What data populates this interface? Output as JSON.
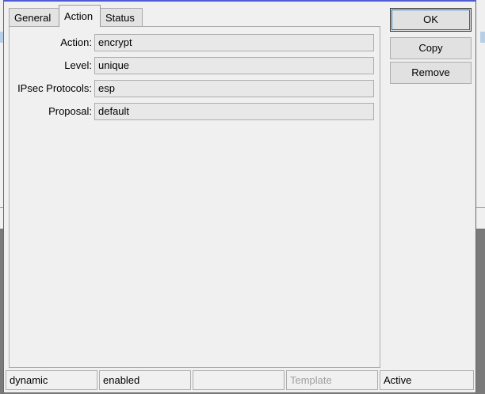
{
  "tabs": [
    {
      "label": "General"
    },
    {
      "label": "Action",
      "active": true
    },
    {
      "label": "Status"
    }
  ],
  "form": {
    "action": {
      "label": "Action:",
      "value": "encrypt"
    },
    "level": {
      "label": "Level:",
      "value": "unique"
    },
    "ipsec_protocols": {
      "label": "IPsec Protocols:",
      "value": "esp"
    },
    "proposal": {
      "label": "Proposal:",
      "value": "default"
    }
  },
  "buttons": {
    "ok": "OK",
    "copy": "Copy",
    "remove": "Remove"
  },
  "status_bar": {
    "cell1": "dynamic",
    "cell2": "enabled",
    "cell3": "",
    "cell4": "Template",
    "cell5": "Active"
  },
  "colors": {
    "window_bg": "#f0f0f0",
    "field_bg": "#e8e8e8",
    "border": "#adadad",
    "disabled_text": "#a0a0a0",
    "title_accent": "#4f5bd5"
  }
}
